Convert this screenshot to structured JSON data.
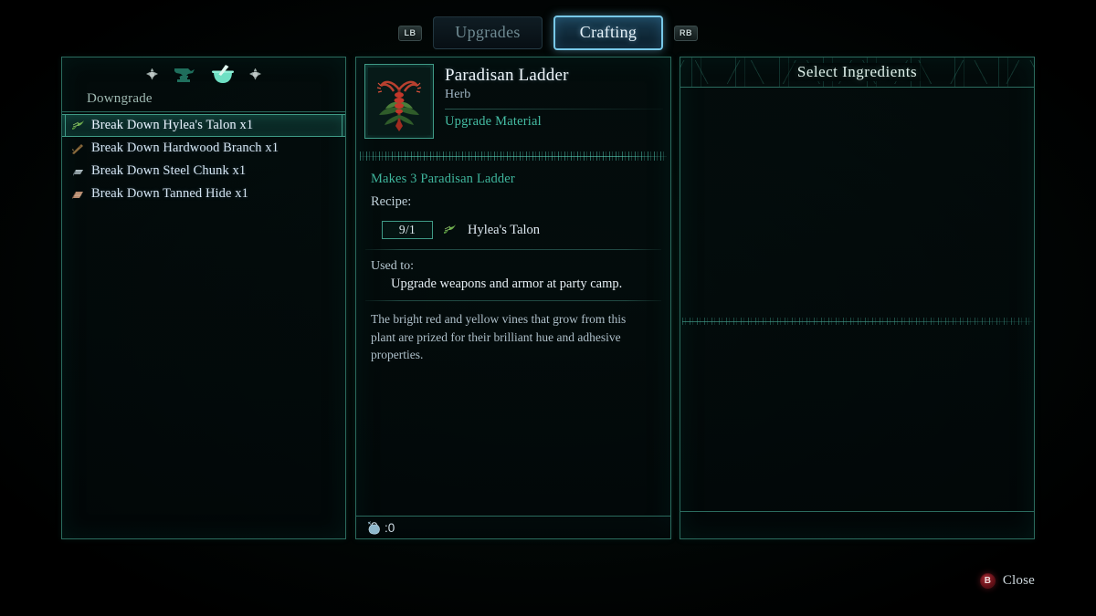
{
  "topbar": {
    "left_bumper": "LB",
    "right_bumper": "RB",
    "tabs": [
      {
        "label": "Upgrades",
        "active": false
      },
      {
        "label": "Crafting",
        "active": true
      }
    ]
  },
  "left_panel": {
    "mode_icons": [
      "dpad-left-icon",
      "anvil-icon",
      "mortar-pestle-icon",
      "dpad-right-icon"
    ],
    "section_label": "Downgrade",
    "rows": [
      {
        "icon": "herb-icon",
        "label": "Break Down Hylea's Talon  x1",
        "selected": true
      },
      {
        "icon": "branch-icon",
        "label": "Break Down Hardwood Branch  x1",
        "selected": false
      },
      {
        "icon": "ingot-icon",
        "label": "Break Down Steel Chunk  x1",
        "selected": false
      },
      {
        "icon": "hide-icon",
        "label": "Break Down Tanned Hide  x1",
        "selected": false
      }
    ]
  },
  "center_panel": {
    "item_icon": "paradisan-ladder-plant-icon",
    "item_name": "Paradisan Ladder",
    "item_type": "Herb",
    "item_category": "Upgrade Material",
    "makes": "Makes 3 Paradisan Ladder",
    "recipe_label": "Recipe:",
    "recipe": [
      {
        "quantity": "9/1",
        "icon": "herb-icon",
        "name": "Hylea's Talon"
      }
    ],
    "used_to_label": "Used to:",
    "used_to_text": "Upgrade weapons and armor at party camp.",
    "description": "The bright red and yellow vines that grow from this plant are prized for their brilliant hue and adhesive properties.",
    "weight_icon": "coin-pouch-icon",
    "weight_value": ":0"
  },
  "right_panel": {
    "title": "Select Ingredients",
    "items": []
  },
  "footer": {
    "close_button_glyph": "B",
    "close_label": "Close"
  },
  "colors": {
    "panel_border": "#2b6b5e",
    "accent_teal": "#45bda4",
    "selection_border": "#3f9a86",
    "active_tab_border": "#78c8e8",
    "text_primary": "#e6eef4",
    "text_muted": "#9fb4c2",
    "close_button_red": "#a02a33",
    "background": "#000000"
  }
}
